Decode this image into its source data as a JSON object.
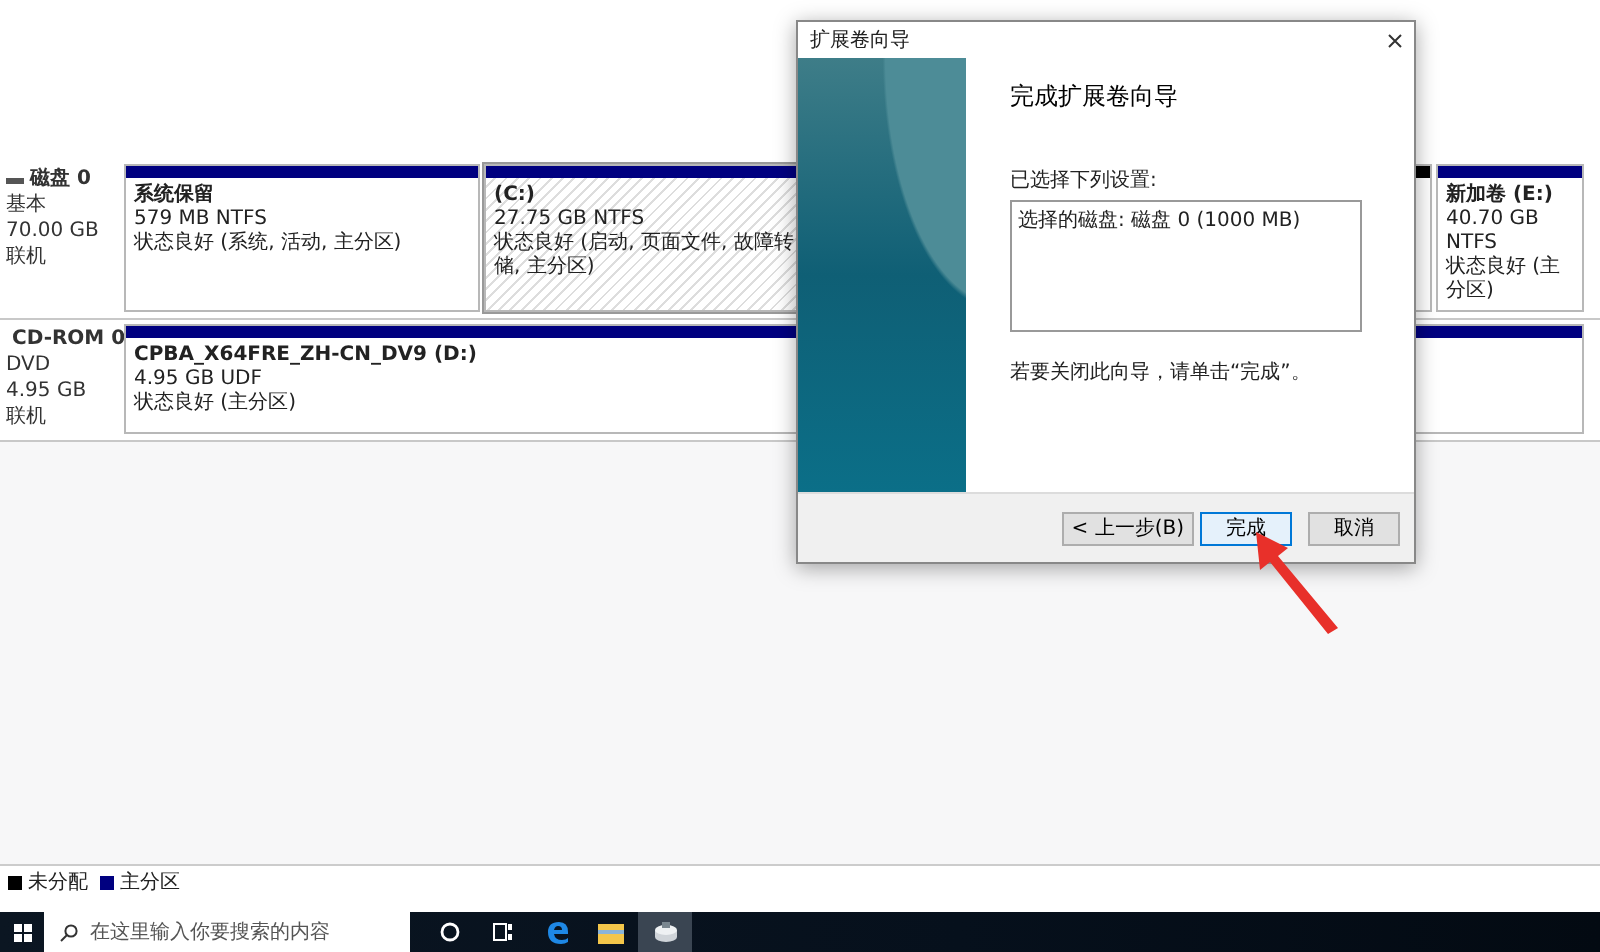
{
  "disks": [
    {
      "kind": "disk",
      "name": "磁盘 0",
      "type": "基本",
      "size": "70.00 GB",
      "status": "联机",
      "partitions": [
        {
          "kind": "primary",
          "selected": false,
          "label": "系统保留",
          "size": "579 MB NTFS",
          "status": "状态良好 (系统, 活动, 主分区)"
        },
        {
          "kind": "primary",
          "selected": true,
          "label": "(C:)",
          "size": "27.75 GB NTFS",
          "status": "状态良好 (启动, 页面文件, 故障转储, 主分区)"
        },
        {
          "kind": "unallocated",
          "selected": false
        },
        {
          "kind": "primary",
          "selected": false,
          "label": "新加卷 (E:)",
          "size": "40.70 GB NTFS",
          "status": "状态良好 (主分区)"
        }
      ]
    },
    {
      "kind": "cdrom",
      "name": "CD-ROM 0",
      "type": "DVD",
      "size": "4.95 GB",
      "status": "联机",
      "partitions": [
        {
          "kind": "primary",
          "selected": false,
          "label": "CPBA_X64FRE_ZH-CN_DV9 (D:)",
          "size": "4.95 GB UDF",
          "status": "状态良好 (主分区)"
        }
      ]
    }
  ],
  "legend": [
    {
      "label": "未分配",
      "color": "#000000"
    },
    {
      "label": "主分区",
      "color": "#000080"
    }
  ],
  "dialog": {
    "title": "扩展卷向导",
    "heading": "完成扩展卷向导",
    "settings_label": "已选择下列设置:",
    "settings": [
      "选择的磁盘: 磁盘 0 (1000 MB)"
    ],
    "instruction": "若要关闭此向导，请单击“完成”。",
    "buttons": [
      {
        "label": "< 上一步(B)",
        "focused": false
      },
      {
        "label": "完成",
        "focused": true
      },
      {
        "label": "取消",
        "focused": false
      }
    ]
  },
  "taskbar": {
    "search_placeholder": "在这里输入你要搜索的内容",
    "apps": [
      {
        "kind": "cortana",
        "active": false
      },
      {
        "kind": "taskview",
        "active": false
      },
      {
        "kind": "edge",
        "active": false
      },
      {
        "kind": "explorer",
        "active": false
      },
      {
        "kind": "diskmgmt",
        "active": true
      }
    ]
  }
}
